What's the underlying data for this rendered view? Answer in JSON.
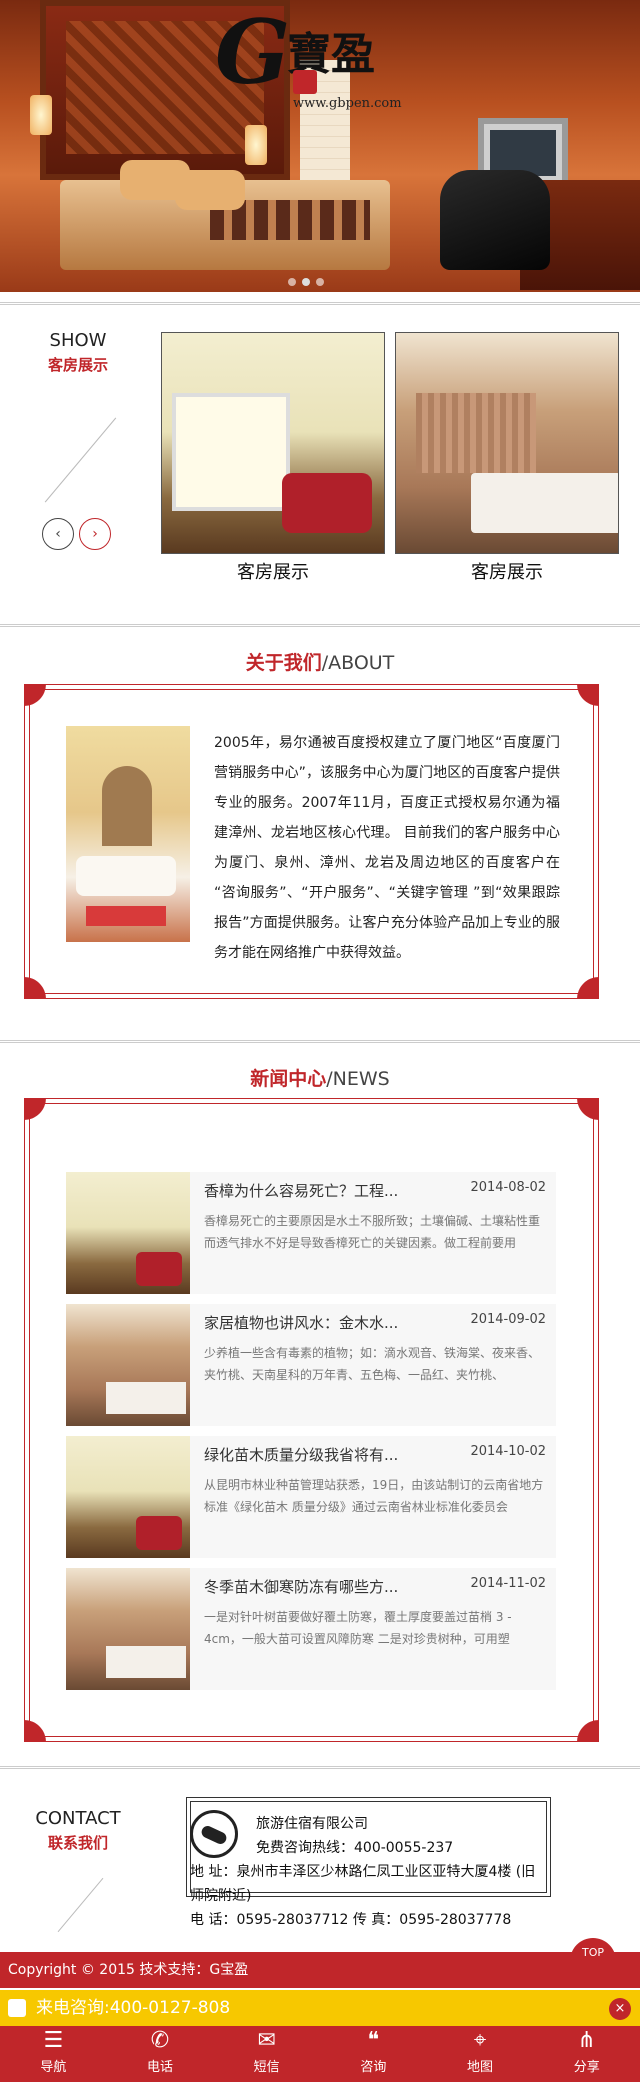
{
  "banner": {
    "logo_letter": "G",
    "logo_text": "寶盈",
    "logo_url": "www.gbpen.com"
  },
  "show": {
    "title_en": "SHOW",
    "title_cn": "客房展示",
    "prev_icon": "‹",
    "next_icon": "›",
    "items": [
      {
        "caption": "客房展示"
      },
      {
        "caption": "客房展示"
      }
    ]
  },
  "about": {
    "title_cn": "关于我们",
    "title_en": "/ABOUT",
    "text": "2005年，易尔通被百度授权建立了厦门地区“百度厦门营销服务中心”，该服务中心为厦门地区的百度客户提供专业的服务。2007年11月，百度正式授权易尔通为福建漳州、龙岩地区核心代理。 目前我们的客户服务中心为厦门、泉州、漳州、龙岩及周边地区的百度客户在 “咨询服务”、“开户服务”、“关键字管理 ”到“效果跟踪报告”方面提供服务。让客户充分体验产品加上专业的服务才能在网络推广中获得效益。"
  },
  "news": {
    "title_cn": "新闻中心",
    "title_en": "/NEWS",
    "items": [
      {
        "title": "香樟为什么容易死亡？工程...",
        "date": "2014-08-02",
        "summary": "香樟易死亡的主要原因是水土不服所致；土壤偏碱、土壤粘性重而透气排水不好是导致香樟死亡的关键因素。做工程前要用"
      },
      {
        "title": "家居植物也讲风水：金木水...",
        "date": "2014-09-02",
        "summary": "少养植一些含有毒素的植物；如：滴水观音、铁海棠、夜来香、夹竹桃、天南星科的万年青、五色梅、一品红、夹竹桃、"
      },
      {
        "title": "绿化苗木质量分级我省将有...",
        "date": "2014-10-02",
        "summary": "从昆明市林业种苗管理站获悉，19日，由该站制订的云南省地方标准《绿化苗木 质量分级》通过云南省林业标准化委员会"
      },
      {
        "title": "冬季苗木御寒防冻有哪些方...",
        "date": "2014-11-02",
        "summary": "一是对针叶树苗要做好覆土防寒，覆土厚度要盖过苗梢 3 - 4cm，一般大苗可设置风障防寒 二是对珍贵树种，可用塑"
      }
    ]
  },
  "contact": {
    "title_en": "CONTACT",
    "title_cn": "联系我们",
    "company": "旅游住宿有限公司",
    "hotline": "免费咨询热线：400-0055-237",
    "address": "地 址：泉州市丰泽区少林路仁凤工业区亚特大厦4楼 (旧师院附近)",
    "phone": "电 话：0595-28037712 传 真：0595-28037778"
  },
  "footer": {
    "copyright": "Copyright © 2015 技术支持：G宝盈",
    "top": "TOP",
    "hotline_label": "来电咨询:400-0127-808",
    "close": "×"
  },
  "nav": [
    {
      "label": "导航",
      "icon": "☰"
    },
    {
      "label": "电话",
      "icon": "✆"
    },
    {
      "label": "短信",
      "icon": "✉"
    },
    {
      "label": "咨询",
      "icon": "❝"
    },
    {
      "label": "地图",
      "icon": "⌖"
    },
    {
      "label": "分享",
      "icon": "⋔"
    }
  ],
  "colors": {
    "accent": "#c0262a",
    "hotline_bar": "#f7c800"
  }
}
